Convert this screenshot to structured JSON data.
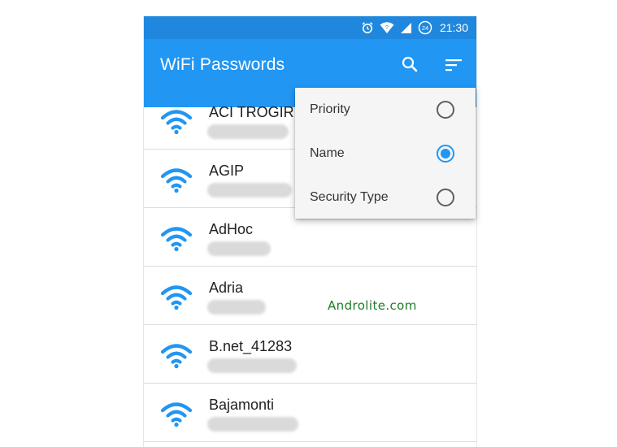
{
  "status_bar": {
    "time": "21:30",
    "icons": [
      "alarm-icon",
      "wifi-signal-icon",
      "cell-signal-icon",
      "data-saver-icon"
    ],
    "badge": "24"
  },
  "app_bar": {
    "title": "WiFi Passwords",
    "actions": [
      "search-icon",
      "sort-icon"
    ]
  },
  "networks": [
    {
      "ssid": "ACI TROGIR",
      "password": ""
    },
    {
      "ssid": "AGIP",
      "password": ""
    },
    {
      "ssid": "AdHoc",
      "password": ""
    },
    {
      "ssid": "Adria",
      "password": ""
    },
    {
      "ssid": "B.net_41283",
      "password": ""
    },
    {
      "ssid": "Bajamonti",
      "password": ""
    }
  ],
  "sort_menu": {
    "options": [
      {
        "label": "Priority",
        "selected": false
      },
      {
        "label": "Name",
        "selected": true
      },
      {
        "label": "Security Type",
        "selected": false
      }
    ]
  },
  "watermark": "Androlite.com",
  "colors": {
    "status_bar": "#1f87dd",
    "app_bar": "#2196f3",
    "accent": "#2196f3",
    "watermark": "#1e7c2a"
  }
}
